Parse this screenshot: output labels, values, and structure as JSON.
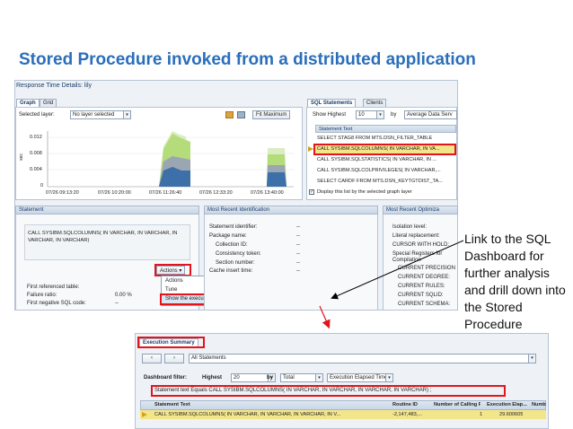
{
  "slide_title": "Stored Procedure invoked from a distributed application",
  "app": {
    "window_title": "Response Time Details: lily",
    "left_tabs": [
      "Graph",
      "Grid"
    ],
    "selected_layer_label": "Selected layer:",
    "selected_layer_value": "No layer selected",
    "fit_button": "Fit Maximum",
    "chart": {
      "ylabel": "sec",
      "yticks": [
        "0.012",
        "0.008",
        "0.004",
        "0"
      ],
      "xticks": [
        "07/26 09:13:20",
        "07/26 10:20:00",
        "07/26 11:26:40",
        "07/26 12:33:20",
        "07/26 13:40:00"
      ]
    },
    "right_tabs": [
      "SQL Statements",
      "Clients"
    ],
    "show_highest_label": "Show Highest",
    "show_highest_value": "10",
    "by_label": "by",
    "by_value": "Average Data Serv",
    "statement_text_header": "Statement Text",
    "statements": [
      "SELECT STAG8 FROM MTS.DSN_FILTER_TABLE",
      "CALL SYSIBM.SQLCOLUMNS( IN VARCHAR, IN VA...",
      "CALL SYSIBM.SQLSTATISTICS( IN VARCHAR, IN ...",
      "CALL SYSIBM.SQLCOLPRIVILEGES( IN VARCHAR,...",
      "SELECT CARDF FROM MTS.DSN_KEYTGTDIST_TA..."
    ],
    "display_list_label": "Display this list by the selected graph layer",
    "statement_panel": {
      "header": "Statement",
      "text": "CALL SYSIBM.SQLCOLUMNS( IN VARCHAR, IN VARCHAR, IN VARCHAR, IN VARCHAR)",
      "actions_button": "Actions",
      "menu_items": [
        "Actions",
        "Tune",
        "Show the execution summary for the selected statement"
      ],
      "rows": [
        {
          "k": "First referenced table:",
          "v": ""
        },
        {
          "k": "Failure ratio:",
          "v": "0.00 %"
        },
        {
          "k": "First negative SQL code:",
          "v": "--"
        }
      ]
    },
    "ident_panel": {
      "header": "Most Recent Identification",
      "rows": [
        {
          "k": "Statement identifier:",
          "v": "--"
        },
        {
          "k": "Package name:",
          "v": "--"
        },
        {
          "k": "Collection ID:",
          "v": "--"
        },
        {
          "k": "Consistency token:",
          "v": "--"
        },
        {
          "k": "Section number:",
          "v": "--"
        },
        {
          "k": "Cache insert time:",
          "v": "--"
        }
      ]
    },
    "opt_panel": {
      "header": "Most Recent Optimiza",
      "rows": [
        "Isolation level:",
        "Literal replacement:",
        "CURSOR WITH HOLD:",
        "Special Registers for Compilation",
        "CURRENT PRECISION",
        "CURRENT DEGREE:",
        "CURRENT RULES:",
        "CURRENT SQLID:",
        "CURRENT SCHEMA:"
      ]
    }
  },
  "annotation": "Link to the SQL Dashboard for further analysis and drill down into the Stored Procedure",
  "exec_summary": {
    "tab": "Execution Summary",
    "breadcrumb": "All Statements",
    "filter_label": "Dashboard filter:",
    "highest_label": "Highest",
    "highest_value": "20",
    "by_label": "by",
    "by_value": "Total",
    "metric_value": "Execution Elapsed Time",
    "filter_text": "Statement text Equals CALL SYSIBM.SQLCOLUMNS( IN VARCHAR, IN VARCHAR, IN VARCHAR, IN VARCHAR) ;",
    "columns": [
      "Statement Text",
      "Routine ID",
      "Number of Calling P...",
      "Execution Elap...",
      "Numb"
    ],
    "row": [
      "CALL SYSIBM.SQLCOLUMNS( IN VARCHAR, IN VARCHAR, IN VARCHAR, IN V...",
      "-2,147,483,...",
      "1",
      "29.600605",
      ""
    ]
  }
}
